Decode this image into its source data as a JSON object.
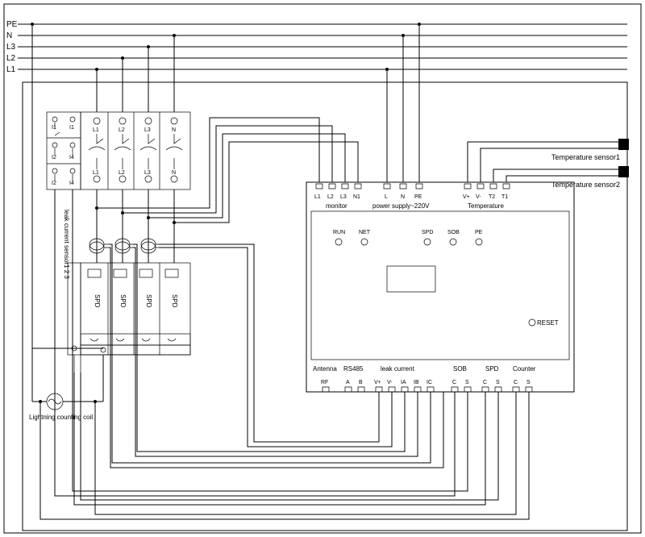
{
  "busbars": {
    "PE": "PE",
    "N": "N",
    "L3": "L3",
    "L2": "L2",
    "L1": "L1"
  },
  "breaker_aux": {
    "top1": "I1",
    "top2": "I1",
    "mid1": "I2",
    "mid2": "I4",
    "bot1": "I2",
    "bot2": "I4"
  },
  "breaker": {
    "top": {
      "L1": "L1",
      "L2": "L2",
      "L3": "L3",
      "N": "N"
    },
    "bot": {
      "L1": "L1",
      "L2": "L2",
      "L3": "L3",
      "N": "N"
    }
  },
  "leak_sensor_label": "leak current sensor1 2 3",
  "spd_label": "SPD",
  "lightning_coil": "Lightning counting coil",
  "temp_sensor1": "Temperature sensor1",
  "temp_sensor2": "Temperature sensor2",
  "monitor": {
    "top_terminals": {
      "L1": "L1",
      "L2": "L2",
      "L3": "L3",
      "N1": "N1",
      "L": "L",
      "N": "N",
      "PE": "PE",
      "Vp": "V+",
      "Vm": "V-",
      "T2": "T2",
      "T1": "T1"
    },
    "top_groups": {
      "monitor": "monitor",
      "power": "power supply~220V",
      "temperature": "Temperature"
    },
    "leds": {
      "RUN": "RUN",
      "NET": "NET",
      "SPD": "SPD",
      "SOB": "SOB",
      "PE": "PE"
    },
    "reset": "RESET",
    "bottom_groups": {
      "antenna": "Antenna",
      "rs485": "RS485",
      "leak_current": "leak current",
      "sob": "SOB",
      "spd": "SPD",
      "counter": "Counter"
    },
    "bottom_terminals": {
      "RF": "RF",
      "A": "A",
      "B": "B",
      "Vp": "V+",
      "Vm": "V-",
      "IA": "IA",
      "IB": "IB",
      "IC": "IC",
      "C1": "C",
      "S1": "S",
      "C2": "C",
      "S2": "S",
      "C3": "C",
      "S3": "S"
    }
  }
}
